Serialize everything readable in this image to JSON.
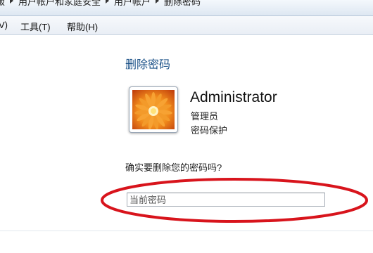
{
  "breadcrumb": {
    "items": [
      "版",
      "用户帐户和家庭安全",
      "用户帐户",
      "删除密码"
    ]
  },
  "menubar": {
    "items": [
      "V)",
      "工具(T)",
      "帮助(H)"
    ]
  },
  "main": {
    "title": "删除密码",
    "user": {
      "name": "Administrator",
      "role": "管理员",
      "status": "密码保护",
      "avatar_icon": "flower-avatar-icon"
    },
    "question": "确实要删除您的密码吗?",
    "current_password": {
      "placeholder": "当前密码",
      "value": ""
    }
  },
  "annotation": {
    "ring_color": "#d8141c"
  },
  "colors": {
    "title": "#1c5288"
  }
}
